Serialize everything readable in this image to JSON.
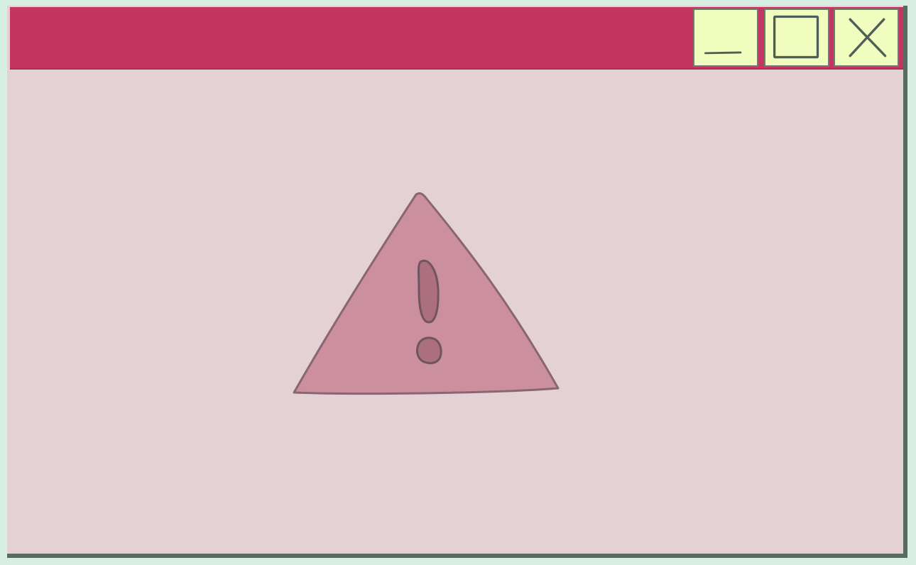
{
  "window": {
    "title": "",
    "colors": {
      "titlebar": "#c4365d",
      "body": "#e4d1d6",
      "control_bg": "#f1fdbf",
      "icon_fill": "#cb8f9d",
      "icon_mark": "#ab6f7d",
      "outline": "#5a6b63"
    },
    "controls": [
      {
        "icon": "minimize-icon"
      },
      {
        "icon": "maximize-icon"
      },
      {
        "icon": "close-icon"
      }
    ]
  },
  "content": {
    "icon": "warning-icon"
  }
}
